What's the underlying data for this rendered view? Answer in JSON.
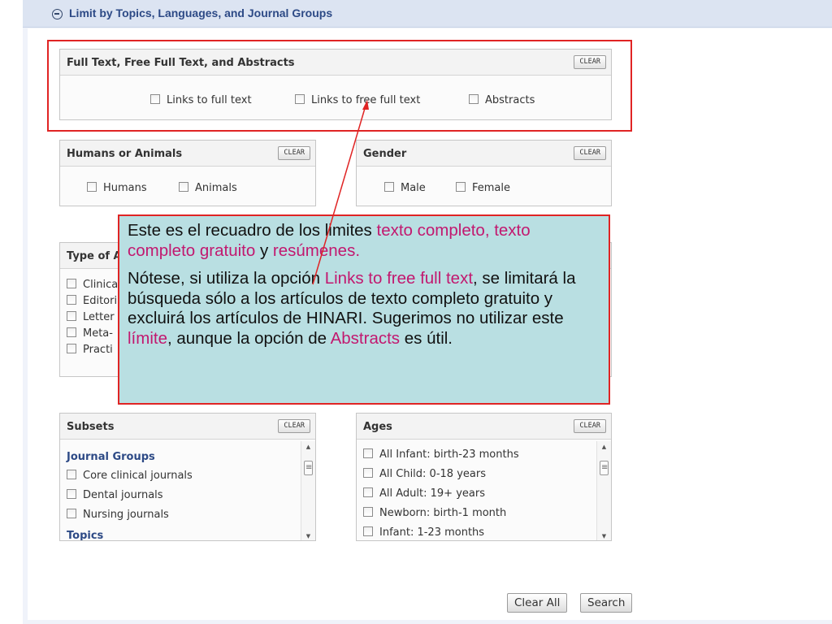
{
  "header": {
    "title": "Limit by Topics, Languages, and Journal Groups"
  },
  "fulltext_box": {
    "title": "Full Text, Free Full Text, and Abstracts",
    "clear": "CLEAR",
    "options": [
      "Links to full text",
      "Links to free full text",
      "Abstracts"
    ]
  },
  "humans_box": {
    "title": "Humans or Animals",
    "clear": "CLEAR",
    "options": [
      "Humans",
      "Animals"
    ]
  },
  "gender_box": {
    "title": "Gender",
    "clear": "CLEAR",
    "options": [
      "Male",
      "Female"
    ]
  },
  "type_box": {
    "title_visible": "Type of A",
    "rows": [
      "Clinica",
      "Editori",
      "Letter",
      "Meta-",
      "Practi"
    ]
  },
  "subsets_box": {
    "title": "Subsets",
    "clear": "CLEAR",
    "group1": "Journal Groups",
    "items": [
      "Core clinical journals",
      "Dental journals",
      "Nursing journals"
    ],
    "group2": "Topics"
  },
  "ages_box": {
    "title": "Ages",
    "clear": "CLEAR",
    "items": [
      "All Infant: birth-23 months",
      "All Child: 0-18 years",
      "All Adult: 19+ years",
      "Newborn: birth-1 month",
      "Infant: 1-23 months"
    ]
  },
  "callout": {
    "p1_a": "Este es el recuadro de los limites ",
    "p1_b": "texto completo, texto completo gratuito",
    "p1_c": " y ",
    "p1_d": "resúmenes.",
    "p2_a": "Nótese, si utiliza la opción ",
    "p2_b": "Links to free full text",
    "p2_c": ", se limitará  la búsqueda sólo a los artículos de texto completo gratuito y excluirá los artículos de HINARI.   Sugerimos no utilizar este ",
    "p2_d": "límite",
    "p2_e": ", aunque la opción de ",
    "p2_f": "Abstracts",
    "p2_g": " es útil."
  },
  "buttons": {
    "clear_all": "Clear All",
    "search": "Search"
  },
  "colors": {
    "accent_red": "#e02424",
    "highlight_magenta": "#c2186f",
    "callout_bg": "#b9dfe2",
    "header_text": "#2d4a86"
  }
}
